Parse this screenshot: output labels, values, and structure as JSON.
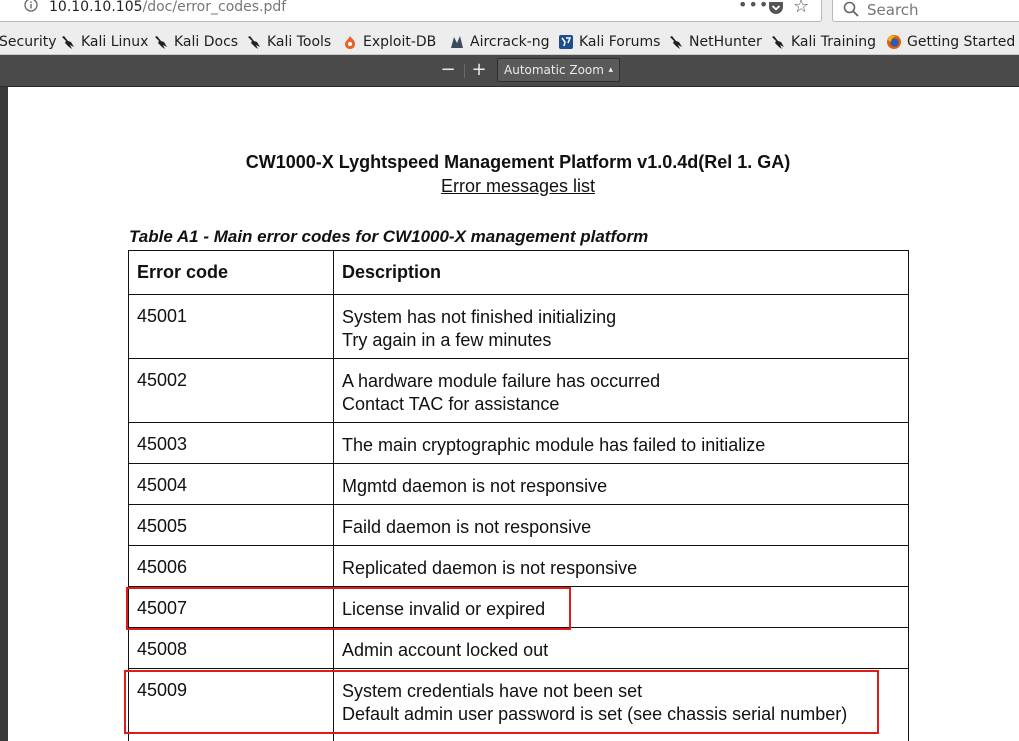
{
  "browser": {
    "url_host": "10.10.10.105",
    "url_path": "/doc/error_codes.pdf",
    "more_label": "•••",
    "search_placeholder": "Search"
  },
  "bookmarks": [
    {
      "label": "Security",
      "icon": "none"
    },
    {
      "label": "Kali Linux",
      "icon": "kali-dragon-icon"
    },
    {
      "label": "Kali Docs",
      "icon": "kali-dragon-icon"
    },
    {
      "label": "Kali Tools",
      "icon": "kali-dragon-icon"
    },
    {
      "label": "Exploit-DB",
      "icon": "exploitdb-icon"
    },
    {
      "label": "Aircrack-ng",
      "icon": "aircrack-icon"
    },
    {
      "label": "Kali Forums",
      "icon": "kali-forums-icon"
    },
    {
      "label": "NetHunter",
      "icon": "kali-dragon-icon"
    },
    {
      "label": "Kali Training",
      "icon": "kali-dragon-icon"
    },
    {
      "label": "Getting Started",
      "icon": "firefox-icon"
    }
  ],
  "pdf_toolbar": {
    "zoom_out": "−",
    "zoom_in": "+",
    "zoom_value": "Automatic Zoom"
  },
  "document": {
    "title": "CW1000-X Lyghtspeed Management Platform v1.0.4d(Rel 1. GA)",
    "subtitle": "Error messages list",
    "caption": "Table A1 - Main error codes for CW1000-X management platform",
    "columns": [
      "Error code",
      "Description"
    ],
    "rows": [
      {
        "code": "45001",
        "lines": [
          "System has not finished initializing",
          "Try again in a few minutes"
        ]
      },
      {
        "code": "45002",
        "lines": [
          "A hardware module failure has occurred",
          "Contact TAC for assistance"
        ]
      },
      {
        "code": "45003",
        "lines": [
          "The main cryptographic module has failed to initialize",
          ""
        ]
      },
      {
        "code": "45004",
        "lines": [
          "Mgmtd daemon is not responsive",
          ""
        ]
      },
      {
        "code": "45005",
        "lines": [
          "Faild daemon is not responsive",
          ""
        ]
      },
      {
        "code": "45006",
        "lines": [
          "Replicated daemon is not responsive",
          ""
        ]
      },
      {
        "code": "45007",
        "lines": [
          "License invalid or expired",
          ""
        ]
      },
      {
        "code": "45008",
        "lines": [
          "Admin account locked out",
          ""
        ]
      },
      {
        "code": "45009",
        "lines": [
          "System credentials have not been set",
          "Default admin user password is set (see chassis serial number)"
        ]
      }
    ]
  },
  "highlight_color": "#e01b1b"
}
